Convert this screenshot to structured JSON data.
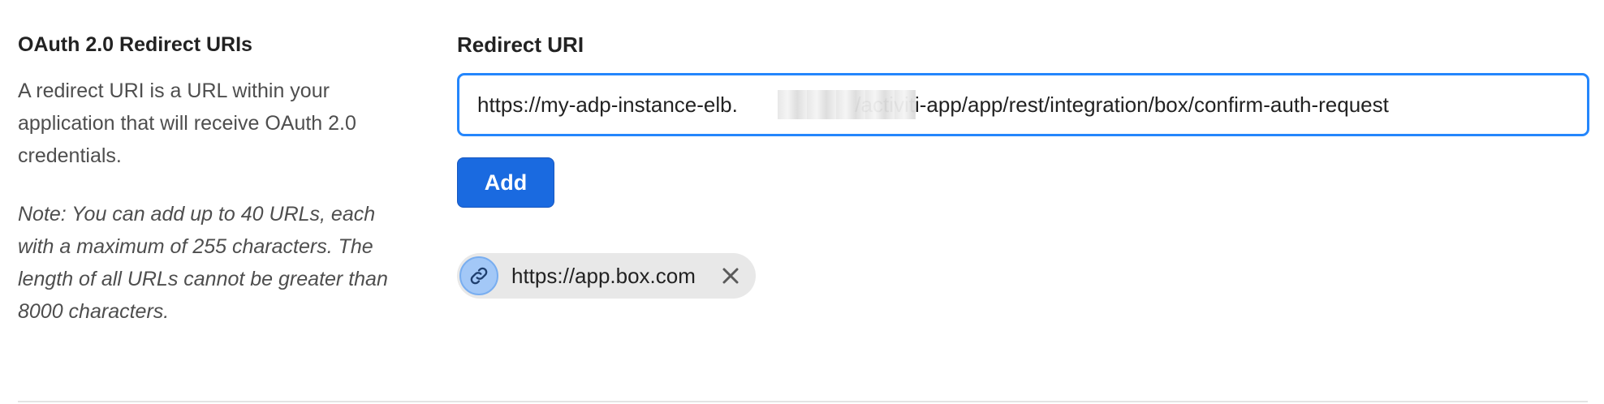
{
  "section": {
    "title": "OAuth 2.0 Redirect URIs",
    "description": "A redirect URI is a URL within your application that will receive OAuth 2.0 credentials.",
    "note": "Note: You can add up to 40 URLs, each with a maximum of 255 characters. The length of all URLs cannot be greater than 8000 characters."
  },
  "form": {
    "field_label": "Redirect URI",
    "input_value": "https://my-adp-instance-elb.                    /activiti-app/app/rest/integration/box/confirm-auth-request",
    "add_label": "Add"
  },
  "uris": [
    {
      "label": "https://app.box.com",
      "icon": "link-icon",
      "remove_icon": "close-icon"
    }
  ],
  "colors": {
    "accent": "#1a6ae0",
    "input_border": "#2486fc",
    "chip_bg": "#e8e8e8",
    "chip_icon_bg": "#a3c8f7"
  }
}
